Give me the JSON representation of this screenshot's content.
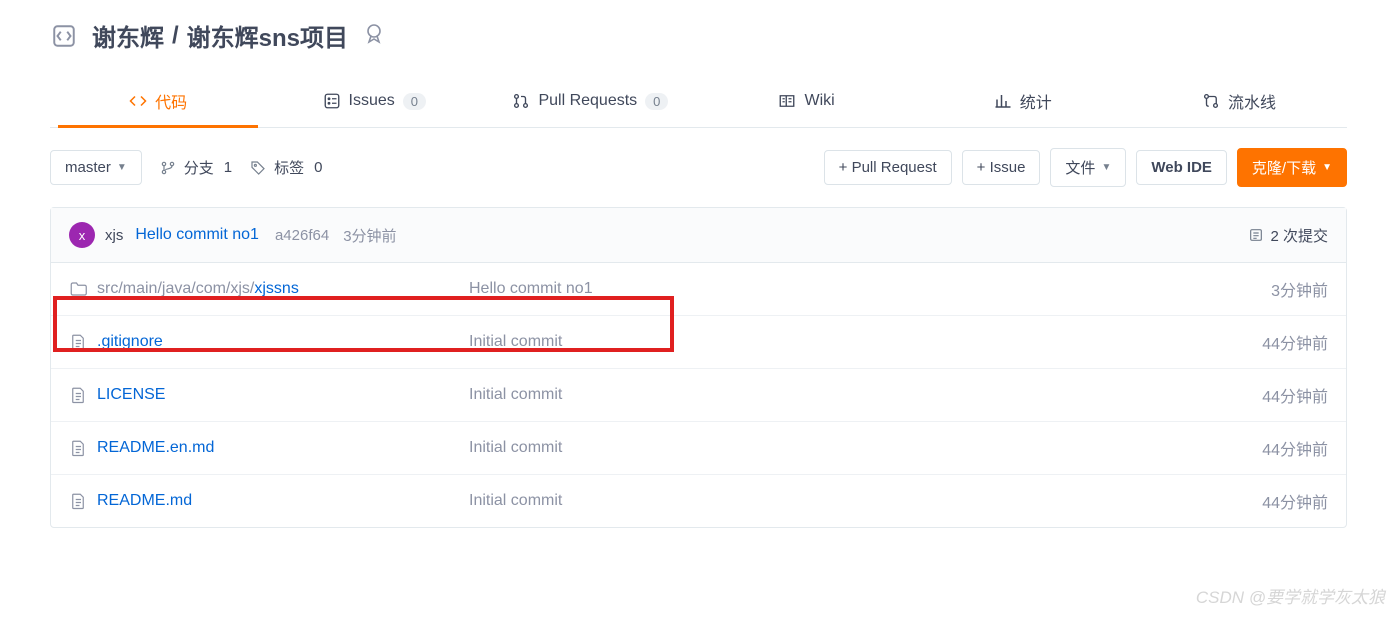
{
  "header": {
    "owner": "谢东辉",
    "repo": "谢东辉sns项目"
  },
  "tabs": [
    {
      "label": "代码",
      "icon": "code",
      "active": true
    },
    {
      "label": "Issues",
      "icon": "issues",
      "count": "0"
    },
    {
      "label": "Pull Requests",
      "icon": "pr",
      "count": "0"
    },
    {
      "label": "Wiki",
      "icon": "wiki"
    },
    {
      "label": "统计",
      "icon": "stats"
    },
    {
      "label": "流水线",
      "icon": "pipeline"
    }
  ],
  "toolbar": {
    "branch_selector": "master",
    "branch_label": "分支",
    "branch_count": "1",
    "tag_label": "标签",
    "tag_count": "0",
    "pull_request_btn": "+ Pull Request",
    "issue_btn": "+ Issue",
    "file_btn": "文件",
    "webide_btn": "Web IDE",
    "clone_btn": "克隆/下载"
  },
  "commit": {
    "avatar_letter": "x",
    "author": "xjs",
    "message": "Hello commit no1",
    "hash": "a426f64",
    "time": "3分钟前",
    "commits_count_text": "2 次提交"
  },
  "files": [
    {
      "type": "folder",
      "name_grey": "src/main/java/com/xjs/",
      "name_link": "xjssns",
      "message": "Hello commit no1",
      "time": "3分钟前"
    },
    {
      "type": "file",
      "name_link": ".gitignore",
      "message": "Initial commit",
      "time": "44分钟前"
    },
    {
      "type": "file",
      "name_link": "LICENSE",
      "message": "Initial commit",
      "time": "44分钟前"
    },
    {
      "type": "file",
      "name_link": "README.en.md",
      "message": "Initial commit",
      "time": "44分钟前"
    },
    {
      "type": "file",
      "name_link": "README.md",
      "message": "Initial commit",
      "time": "44分钟前"
    }
  ],
  "watermark": "CSDN @要学就学灰太狼"
}
